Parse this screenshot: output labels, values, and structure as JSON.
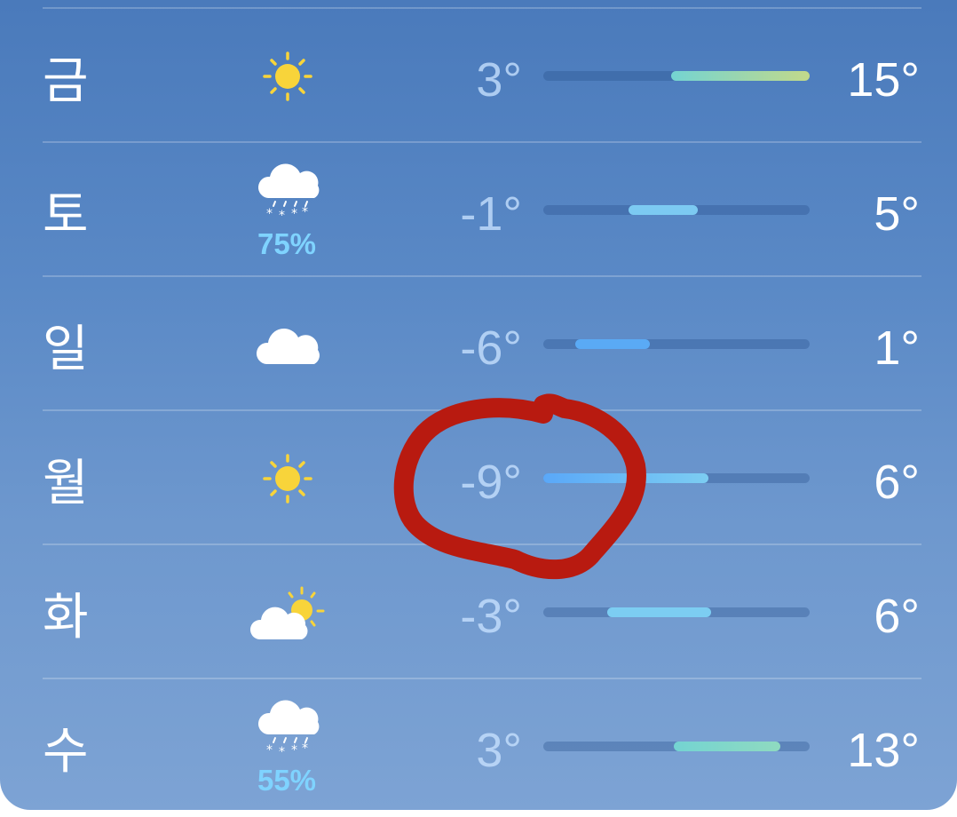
{
  "forecast": {
    "rows": [
      {
        "day": "금",
        "icon": "sun-icon",
        "precip": "",
        "low": "3°",
        "high": "15°",
        "bar_start": 0.48,
        "bar_end": 1.0,
        "bar_colors": [
          "#74d4d2",
          "#c2d98a"
        ]
      },
      {
        "day": "토",
        "icon": "snow-cloud-icon",
        "precip": "75%",
        "low": "-1°",
        "high": "5°",
        "bar_start": 0.32,
        "bar_end": 0.58,
        "bar_colors": [
          "#7ccaf2",
          "#7ccaf2"
        ]
      },
      {
        "day": "일",
        "icon": "cloud-icon",
        "precip": "",
        "low": "-6°",
        "high": "1°",
        "bar_start": 0.12,
        "bar_end": 0.4,
        "bar_colors": [
          "#5aaaf5",
          "#5aaaf5"
        ]
      },
      {
        "day": "월",
        "icon": "sun-icon",
        "precip": "",
        "low": "-9°",
        "high": "6°",
        "bar_start": 0.0,
        "bar_end": 0.62,
        "bar_colors": [
          "#5aa8f8",
          "#7ccdf2"
        ]
      },
      {
        "day": "화",
        "icon": "partly-cloudy-icon",
        "precip": "",
        "low": "-3°",
        "high": "6°",
        "bar_start": 0.24,
        "bar_end": 0.63,
        "bar_colors": [
          "#7ccdf2",
          "#7ccdf2"
        ]
      },
      {
        "day": "수",
        "icon": "snow-cloud-icon",
        "precip": "55%",
        "low": "3°",
        "high": "13°",
        "bar_start": 0.49,
        "bar_end": 0.89,
        "bar_colors": [
          "#74d4d2",
          "#8fdac0"
        ]
      }
    ]
  },
  "colors": {
    "annotation": "#b81a10",
    "sun": "#f8d43a",
    "cloud": "#ffffff",
    "snow": "#ffffff"
  }
}
